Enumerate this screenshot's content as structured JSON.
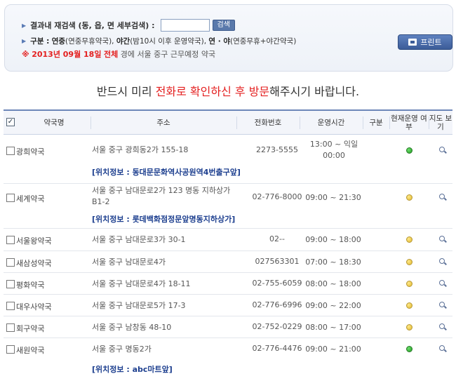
{
  "search": {
    "label": "결과내 재검색 (동, 읍, 면 세부검색) :",
    "value": "",
    "placeholder": "",
    "button_label": "검색"
  },
  "legend": {
    "prefix": "구분 :",
    "day_title": "연중",
    "day_desc": "(연중무휴약국),",
    "night_title": "야간",
    "night_desc": "(밤10시 이후 운영약국),",
    "both_title": "연 · 야",
    "both_desc": "(연중무휴+야간약국)"
  },
  "date_line": {
    "marker": "※",
    "date": "2013년 09월 18일",
    "scope": "전체",
    "suffix": "경에 서울 중구 근무예정 약국"
  },
  "print_button": "프린트",
  "notice": {
    "before": "반드시 미리 ",
    "highlight": "전화로 확인하신 후 방문",
    "after": "해주시기 바랍니다."
  },
  "table": {
    "headers": {
      "name": "약국명",
      "address": "주소",
      "phone": "전화번호",
      "hours": "운영시간",
      "type": "구분",
      "status": "현재운영 여부",
      "map": "지도 보기"
    },
    "rows": [
      {
        "name": "광희약국",
        "address": "서울 중구 광희동2가 155-18",
        "phone": "2273-5555",
        "hours": "13:00 ~ 익일 00:00",
        "status": "green",
        "location": "[위치정보 : 동대문문화역사공원역4번출구앞]"
      },
      {
        "name": "세계약국",
        "address": "서울 중구 남대문로2가 123 명동 지하상가 B1-2",
        "phone": "02-776-8000",
        "hours": "09:00 ~ 21:30",
        "status": "yellow",
        "location": "[위치정보 : 롯데백화점정문앞명동지하상가]"
      },
      {
        "name": "서울왕약국",
        "address": "서울 중구 남대문로3가 30-1",
        "phone": "02--",
        "hours": "09:00 ~ 18:00",
        "status": "yellow",
        "location": ""
      },
      {
        "name": "새삼성약국",
        "address": "서울 중구 남대문로4가",
        "phone": "027563301",
        "hours": "07:00 ~ 18:30",
        "status": "yellow",
        "location": ""
      },
      {
        "name": "평화약국",
        "address": "서울 중구 남대문로4가 18-11",
        "phone": "02-755-6059",
        "hours": "08:00 ~ 18:00",
        "status": "yellow",
        "location": ""
      },
      {
        "name": "대우사약국",
        "address": "서울 중구 남대문로5가 17-3",
        "phone": "02-776-6996",
        "hours": "09:00 ~ 22:00",
        "status": "yellow",
        "location": ""
      },
      {
        "name": "회구약국",
        "address": "서울 중구 남창동 48-10",
        "phone": "02-752-0229",
        "hours": "08:00 ~ 17:00",
        "status": "yellow",
        "location": ""
      },
      {
        "name": "새원약국",
        "address": "서울 중구 명동2가",
        "phone": "02-776-4476",
        "hours": "09:00 ~ 21:00",
        "status": "green",
        "location": "[위치정보 : abc마트앞]"
      }
    ]
  }
}
